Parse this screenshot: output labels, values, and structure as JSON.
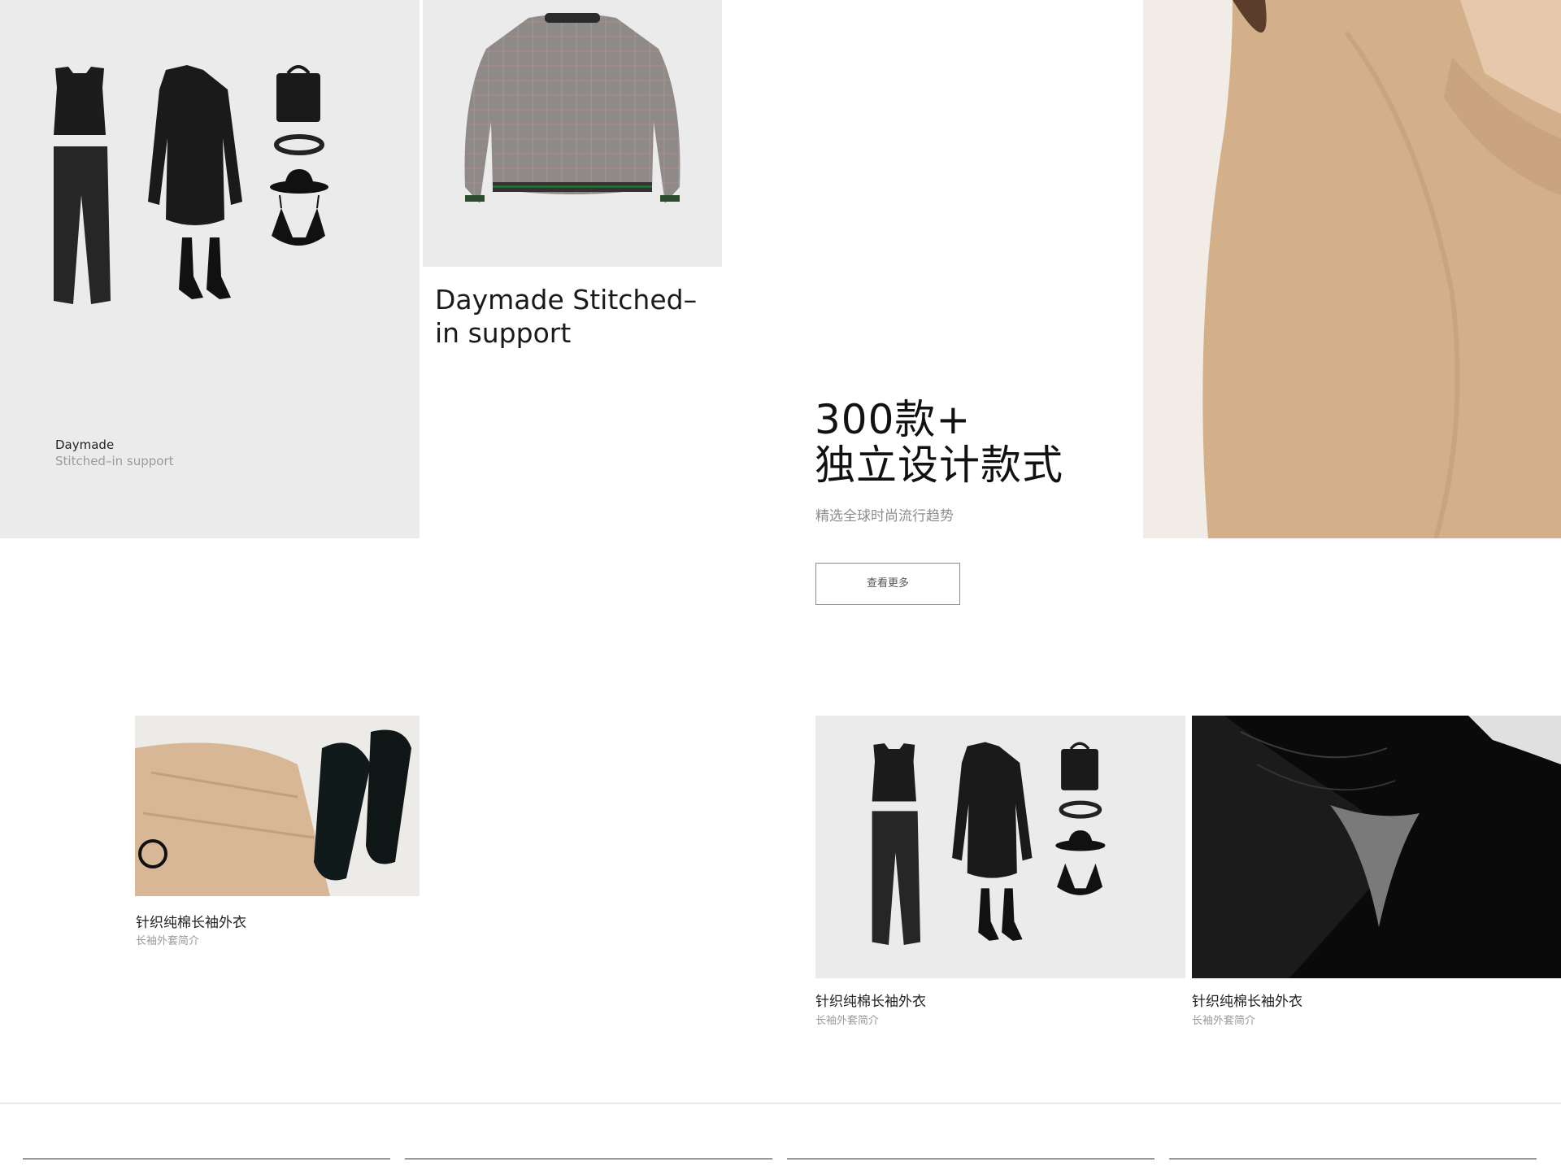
{
  "outfit_card": {
    "caption_title": "Daymade",
    "caption_subtitle": "Stitched–in support"
  },
  "sweater_card": {
    "title": "Daymade Stitched–in support"
  },
  "hero": {
    "heading_line1": "300款+",
    "heading_line2": "独立设计款式",
    "subtitle": "精选全球时尚流行趋势",
    "button_label": "查看更多"
  },
  "products": [
    {
      "title": "针织纯棉长袖外衣",
      "subtitle": "长袖外套简介"
    },
    {
      "title": "针织纯棉长袖外衣",
      "subtitle": "长袖外套简介"
    },
    {
      "title": "针织纯棉长袖外衣",
      "subtitle": "长袖外套简介"
    }
  ],
  "colors": {
    "panel_gray": "#ebebeb",
    "text_dark": "#111111",
    "text_muted": "#9a9a9a",
    "sweater_tan": "#d4b08a",
    "border": "#8d8d8d"
  }
}
